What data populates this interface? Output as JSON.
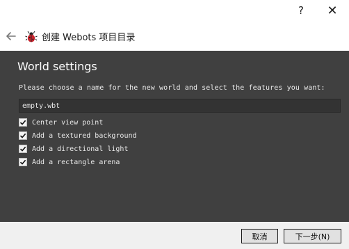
{
  "titlebar": {
    "help_label": "?",
    "close_label": "✕"
  },
  "header": {
    "title": "创建 Webots 项目目录"
  },
  "content": {
    "section_title": "World settings",
    "prompt": "Please choose a name for the new world and select the features you want:",
    "world_name_value": "empty.wbt",
    "options": [
      {
        "label": "Center view point",
        "checked": true
      },
      {
        "label": "Add a textured background",
        "checked": true
      },
      {
        "label": "Add a directional light",
        "checked": true
      },
      {
        "label": "Add a rectangle arena",
        "checked": true
      }
    ]
  },
  "footer": {
    "cancel_label": "取消",
    "next_label": "下一步(N)"
  },
  "colors": {
    "content_bg": "#404040",
    "window_bg": "#f0f0f0",
    "checkbox_bg": "#f4f4f4"
  },
  "icons": {
    "back": "arrow-left-icon",
    "app": "webots-bug-icon",
    "help": "help-icon",
    "close": "close-icon",
    "check": "checkmark-icon"
  }
}
